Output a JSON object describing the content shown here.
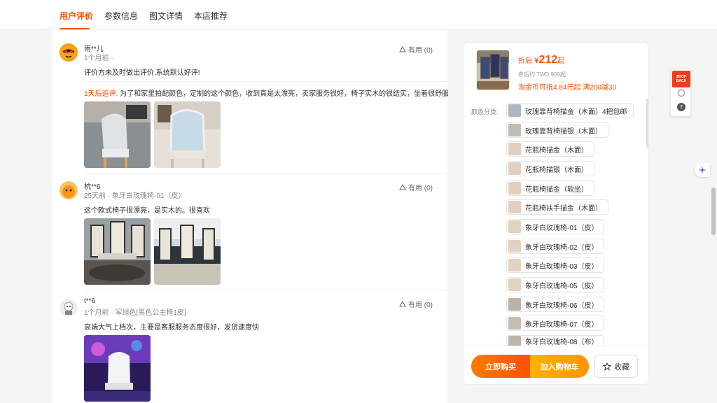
{
  "tabs": [
    {
      "label": "用户评价",
      "active": true
    },
    {
      "label": "参数信息"
    },
    {
      "label": "图文详情"
    },
    {
      "label": "本店推荐"
    }
  ],
  "reviews": [
    {
      "user": "雨**儿",
      "meta": "1个月前 ·",
      "useful": "有用 (0)",
      "text": "评价方未及时做出评价,系统默认好评!",
      "followup_tag": "1天后追评:",
      "followup_text": "为了和家里拍配颜色，定制的这个颜色，收到真是太漂亮，卖家服务很好，椅子实木的很结实，坐着很舒服"
    },
    {
      "user": "杭**6",
      "meta": "25天前 · 象牙白玫瑰椅-01（皮）",
      "useful": "有用 (0)",
      "text": "这个欧式椅子很漂亮，是实木的。很喜欢"
    },
    {
      "user": "t**6",
      "meta": "1个月前 · 军绿色[黑色公主椅1皮]",
      "useful": "有用 (0)",
      "text": "高端大气上档次，主要是客服服务态度很好，发货速度快"
    }
  ],
  "product": {
    "price_label": "折后",
    "currency": "¥",
    "price": "212",
    "price_suffix": "起",
    "price_sub": "券后约 TWD 969起",
    "coupon": "淘金币可抵4.84元起 满200减30",
    "color_label": "颜色分类:",
    "options": [
      "玫瑰靠背椅描金（木面）4把包邮",
      "玫瑰靠背椅描银（木面）",
      "花瓶椅描金（木面）",
      "花瓶椅描银（木面）",
      "花瓶椅描金（软坐）",
      "花瓶椅扶手描金（木面）",
      "象牙白玫瑰椅-01（皮）",
      "象牙白玫瑰椅-02（皮）",
      "象牙白玫瑰椅-03（皮）",
      "象牙白玫瑰椅-05（皮）",
      "象牙白玫瑰椅-06（皮）",
      "象牙白玫瑰椅-07（皮）",
      "象牙白玫瑰椅-08（布）"
    ],
    "buy_label": "立即购买",
    "cart_label": "加入购物车",
    "fav_label": "收藏"
  },
  "widgets": {
    "shopback_text": "SHOP BACK",
    "help_icon": "question-icon"
  },
  "colors": {
    "accent": "#ff5000",
    "cart": "#ffa000"
  }
}
